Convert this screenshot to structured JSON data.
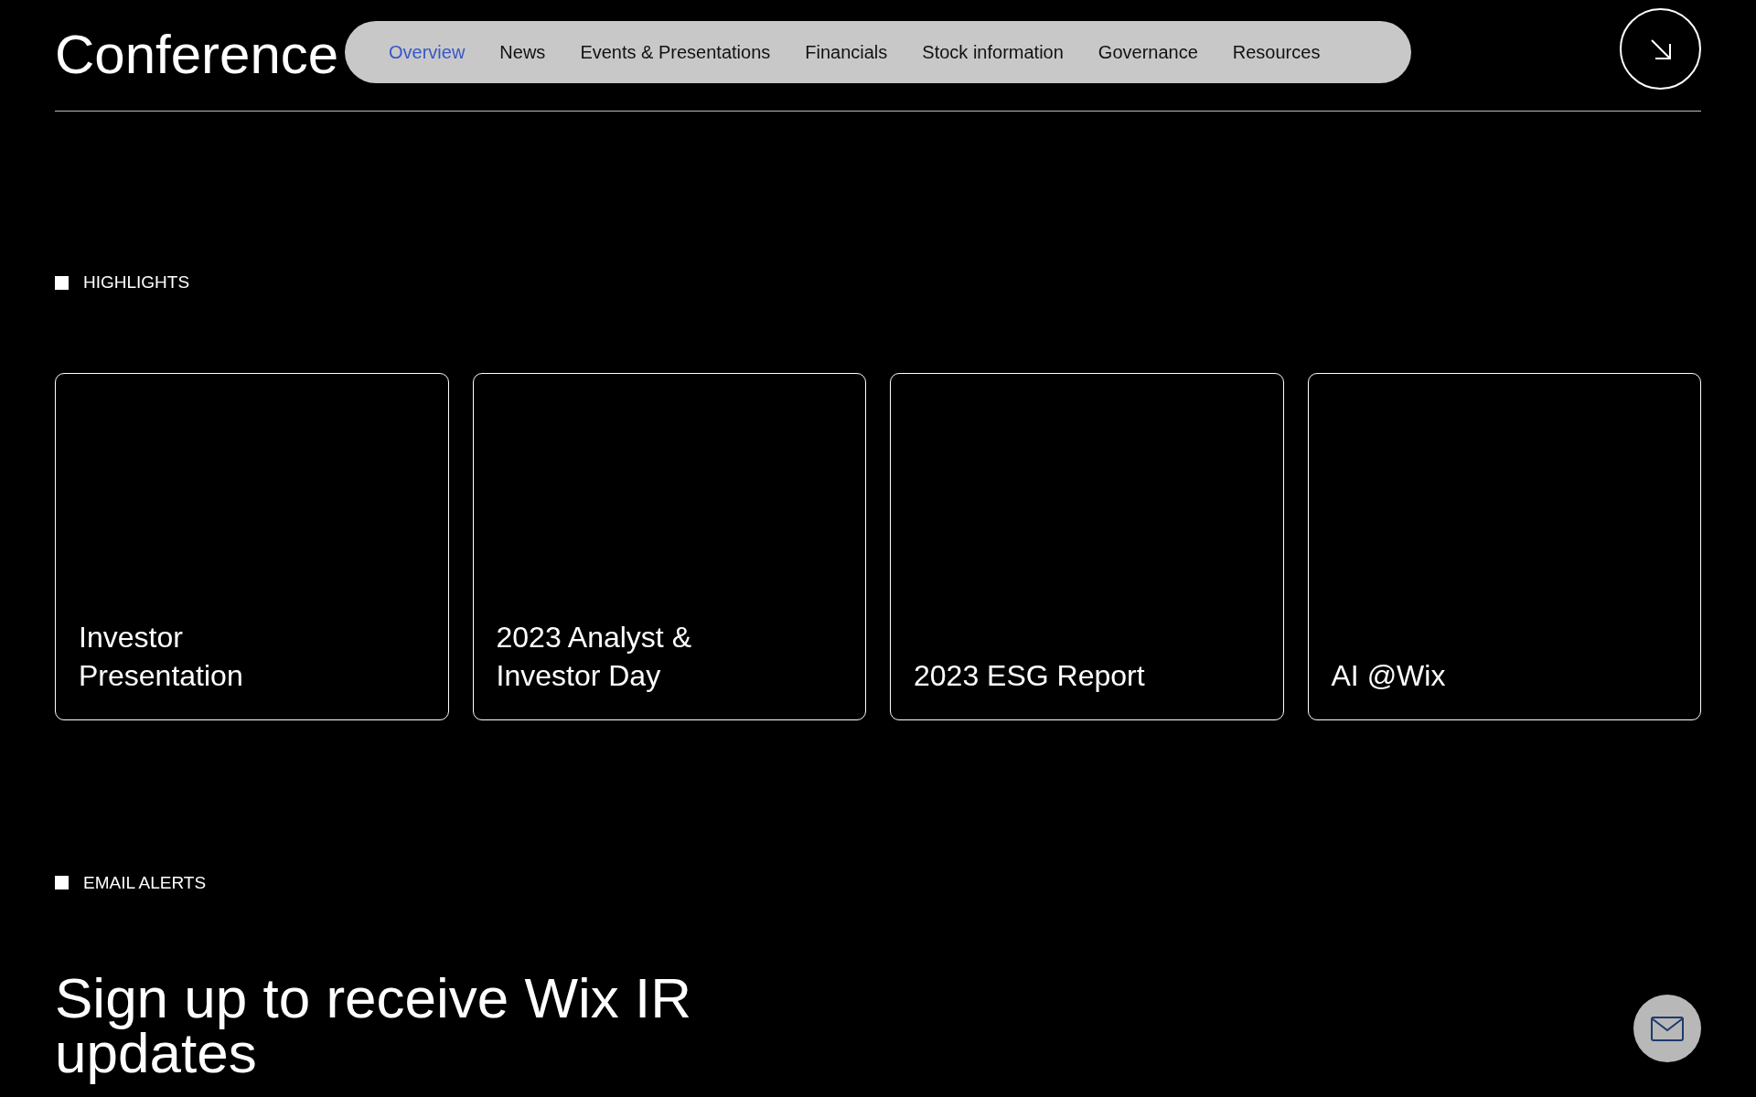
{
  "page_title": "Conference",
  "nav": {
    "items": [
      {
        "label": "Overview",
        "selected": true
      },
      {
        "label": "News",
        "selected": false
      },
      {
        "label": "Events & Presentations",
        "selected": false
      },
      {
        "label": "Financials",
        "selected": false
      },
      {
        "label": "Stock information",
        "selected": false
      },
      {
        "label": "Governance",
        "selected": false
      },
      {
        "label": "Resources",
        "selected": false
      }
    ]
  },
  "highlights": {
    "label": "HIGHLIGHTS",
    "cards": [
      {
        "title": "Investor Presentation"
      },
      {
        "title": "2023 Analyst & Investor Day"
      },
      {
        "title": "2023 ESG Report"
      },
      {
        "title": "AI @Wix"
      }
    ]
  },
  "email_alerts": {
    "label": "EMAIL ALERTS",
    "heading": "Sign up to receive Wix IR updates"
  }
}
